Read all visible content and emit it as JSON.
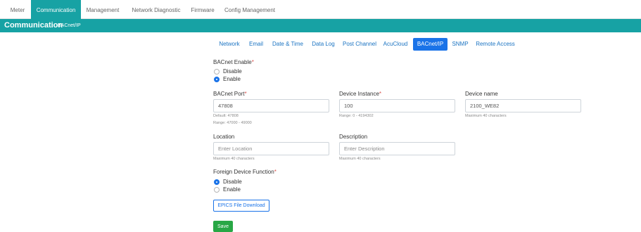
{
  "top_nav": {
    "tabs": [
      {
        "label": "Meter"
      },
      {
        "label": "Communication"
      },
      {
        "label": "Management"
      },
      {
        "label": "Network Diagnostic"
      },
      {
        "label": "Firmware"
      },
      {
        "label": "Config Management"
      }
    ],
    "active_index": 1
  },
  "header": {
    "title": "Communication",
    "subtitle": "BACnet/IP"
  },
  "sub_tabs": {
    "tabs": [
      {
        "label": "Network"
      },
      {
        "label": "Email"
      },
      {
        "label": "Date & Time"
      },
      {
        "label": "Data Log"
      },
      {
        "label": "Post Channel"
      },
      {
        "label": "AcuCloud"
      },
      {
        "label": "BACnet/IP"
      },
      {
        "label": "SNMP"
      },
      {
        "label": "Remote Access"
      }
    ],
    "active_index": 6
  },
  "form": {
    "bacnet_enable": {
      "label": "BACnet Enable",
      "required_mark": "*",
      "options": [
        {
          "label": "Disable",
          "selected": false
        },
        {
          "label": "Enable",
          "selected": true
        }
      ]
    },
    "bacnet_port": {
      "label": "BACnet Port",
      "required_mark": "*",
      "value": "47808",
      "hint_default": "Default: 47808",
      "hint_range": "Range: 47000 - 49000"
    },
    "device_instance": {
      "label": "Device Instance",
      "required_mark": "*",
      "value": "100",
      "hint": "Range: 0 - 4194302"
    },
    "device_name": {
      "label": "Device name",
      "value": "2100_WE82",
      "hint": "Maximum 40 characters"
    },
    "location": {
      "label": "Location",
      "placeholder": "Enter Location",
      "hint": "Maximum 40 characters"
    },
    "description": {
      "label": "Description",
      "placeholder": "Enter Description",
      "hint": "Maximum 40 characters"
    },
    "foreign_device": {
      "label": "Foreign Device Function",
      "required_mark": "*",
      "options": [
        {
          "label": "Disable",
          "selected": true
        },
        {
          "label": "Enable",
          "selected": false
        }
      ]
    },
    "epics_button": "EPICS File Download",
    "save_button": "Save"
  },
  "colors": {
    "brand_teal": "#17a2a4",
    "accent_blue": "#1a73e8",
    "save_green": "#28a745",
    "required_red": "#d9534f"
  }
}
